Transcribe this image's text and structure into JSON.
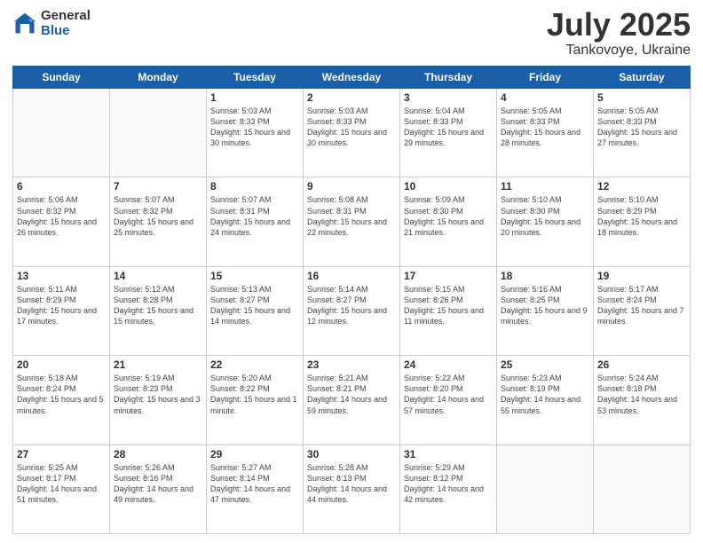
{
  "header": {
    "logo_general": "General",
    "logo_blue": "Blue",
    "month": "July 2025",
    "location": "Tankovoye, Ukraine"
  },
  "weekdays": [
    "Sunday",
    "Monday",
    "Tuesday",
    "Wednesday",
    "Thursday",
    "Friday",
    "Saturday"
  ],
  "weeks": [
    [
      {
        "day": "",
        "info": ""
      },
      {
        "day": "",
        "info": ""
      },
      {
        "day": "1",
        "info": "Sunrise: 5:03 AM\nSunset: 8:33 PM\nDaylight: 15 hours\nand 30 minutes."
      },
      {
        "day": "2",
        "info": "Sunrise: 5:03 AM\nSunset: 8:33 PM\nDaylight: 15 hours\nand 30 minutes."
      },
      {
        "day": "3",
        "info": "Sunrise: 5:04 AM\nSunset: 8:33 PM\nDaylight: 15 hours\nand 29 minutes."
      },
      {
        "day": "4",
        "info": "Sunrise: 5:05 AM\nSunset: 8:33 PM\nDaylight: 15 hours\nand 28 minutes."
      },
      {
        "day": "5",
        "info": "Sunrise: 5:05 AM\nSunset: 8:33 PM\nDaylight: 15 hours\nand 27 minutes."
      }
    ],
    [
      {
        "day": "6",
        "info": "Sunrise: 5:06 AM\nSunset: 8:32 PM\nDaylight: 15 hours\nand 26 minutes."
      },
      {
        "day": "7",
        "info": "Sunrise: 5:07 AM\nSunset: 8:32 PM\nDaylight: 15 hours\nand 25 minutes."
      },
      {
        "day": "8",
        "info": "Sunrise: 5:07 AM\nSunset: 8:31 PM\nDaylight: 15 hours\nand 24 minutes."
      },
      {
        "day": "9",
        "info": "Sunrise: 5:08 AM\nSunset: 8:31 PM\nDaylight: 15 hours\nand 22 minutes."
      },
      {
        "day": "10",
        "info": "Sunrise: 5:09 AM\nSunset: 8:30 PM\nDaylight: 15 hours\nand 21 minutes."
      },
      {
        "day": "11",
        "info": "Sunrise: 5:10 AM\nSunset: 8:30 PM\nDaylight: 15 hours\nand 20 minutes."
      },
      {
        "day": "12",
        "info": "Sunrise: 5:10 AM\nSunset: 8:29 PM\nDaylight: 15 hours\nand 18 minutes."
      }
    ],
    [
      {
        "day": "13",
        "info": "Sunrise: 5:11 AM\nSunset: 8:29 PM\nDaylight: 15 hours\nand 17 minutes."
      },
      {
        "day": "14",
        "info": "Sunrise: 5:12 AM\nSunset: 8:28 PM\nDaylight: 15 hours\nand 15 minutes."
      },
      {
        "day": "15",
        "info": "Sunrise: 5:13 AM\nSunset: 8:27 PM\nDaylight: 15 hours\nand 14 minutes."
      },
      {
        "day": "16",
        "info": "Sunrise: 5:14 AM\nSunset: 8:27 PM\nDaylight: 15 hours\nand 12 minutes."
      },
      {
        "day": "17",
        "info": "Sunrise: 5:15 AM\nSunset: 8:26 PM\nDaylight: 15 hours\nand 11 minutes."
      },
      {
        "day": "18",
        "info": "Sunrise: 5:16 AM\nSunset: 8:25 PM\nDaylight: 15 hours\nand 9 minutes."
      },
      {
        "day": "19",
        "info": "Sunrise: 5:17 AM\nSunset: 8:24 PM\nDaylight: 15 hours\nand 7 minutes."
      }
    ],
    [
      {
        "day": "20",
        "info": "Sunrise: 5:18 AM\nSunset: 8:24 PM\nDaylight: 15 hours\nand 5 minutes."
      },
      {
        "day": "21",
        "info": "Sunrise: 5:19 AM\nSunset: 8:23 PM\nDaylight: 15 hours\nand 3 minutes."
      },
      {
        "day": "22",
        "info": "Sunrise: 5:20 AM\nSunset: 8:22 PM\nDaylight: 15 hours\nand 1 minute."
      },
      {
        "day": "23",
        "info": "Sunrise: 5:21 AM\nSunset: 8:21 PM\nDaylight: 14 hours\nand 59 minutes."
      },
      {
        "day": "24",
        "info": "Sunrise: 5:22 AM\nSunset: 8:20 PM\nDaylight: 14 hours\nand 57 minutes."
      },
      {
        "day": "25",
        "info": "Sunrise: 5:23 AM\nSunset: 8:19 PM\nDaylight: 14 hours\nand 55 minutes."
      },
      {
        "day": "26",
        "info": "Sunrise: 5:24 AM\nSunset: 8:18 PM\nDaylight: 14 hours\nand 53 minutes."
      }
    ],
    [
      {
        "day": "27",
        "info": "Sunrise: 5:25 AM\nSunset: 8:17 PM\nDaylight: 14 hours\nand 51 minutes."
      },
      {
        "day": "28",
        "info": "Sunrise: 5:26 AM\nSunset: 8:16 PM\nDaylight: 14 hours\nand 49 minutes."
      },
      {
        "day": "29",
        "info": "Sunrise: 5:27 AM\nSunset: 8:14 PM\nDaylight: 14 hours\nand 47 minutes."
      },
      {
        "day": "30",
        "info": "Sunrise: 5:28 AM\nSunset: 8:13 PM\nDaylight: 14 hours\nand 44 minutes."
      },
      {
        "day": "31",
        "info": "Sunrise: 5:29 AM\nSunset: 8:12 PM\nDaylight: 14 hours\nand 42 minutes."
      },
      {
        "day": "",
        "info": ""
      },
      {
        "day": "",
        "info": ""
      }
    ]
  ]
}
